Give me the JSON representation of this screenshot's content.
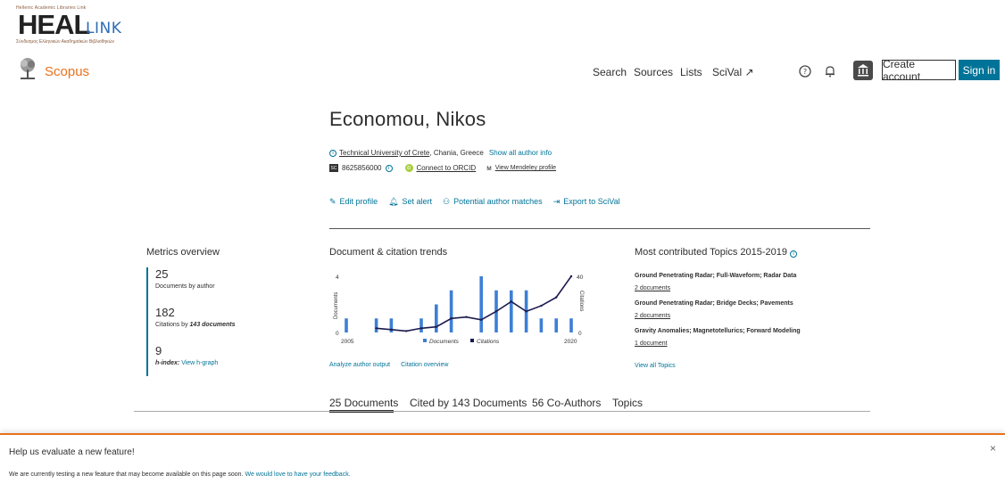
{
  "logo": {
    "tagline": "Hellenic Academic Libraries Link",
    "big": "HEAL",
    "link": "LINK",
    "subtitle": "Σύνδεσμος Ελληνικών Ακαδημαϊκών Βιβλιοθηκών"
  },
  "header": {
    "brand": "Scopus",
    "nav": {
      "search": "Search",
      "sources": "Sources",
      "lists": "Lists",
      "scival": "SciVal ↗"
    },
    "create_account": "Create account",
    "sign_in": "Sign in"
  },
  "author": {
    "name": "Economou, Nikos",
    "affiliation_link": "Technical University of Crete",
    "affiliation_rest": ", Chania, Greece",
    "show_all": "Show all author info",
    "scopus_id": "8625856000",
    "orcid": "Connect to ORCID",
    "mendeley": "View Mendeley profile"
  },
  "actions": {
    "edit": "Edit profile",
    "alert": "Set alert",
    "matches": "Potential author matches",
    "export": "Export to SciVal"
  },
  "metrics": {
    "title": "Metrics overview",
    "documents": "25",
    "documents_label": "Documents by author",
    "citations": "182",
    "citations_label_pre": "Citations by ",
    "citations_label_docs": "143 documents",
    "hindex": "9",
    "hindex_label": "h-index:",
    "hindex_link": "View h-graph"
  },
  "trends": {
    "title": "Document & citation trends",
    "analyze": "Analyze author output",
    "overview": "Citation overview"
  },
  "chart_data": {
    "type": "bar",
    "x_start": "2005",
    "x_end": "2020",
    "ylabel": "Documents",
    "y2label": "Citations",
    "ylim": [
      0,
      4
    ],
    "y2lim": [
      0,
      40
    ],
    "y_ticks": [
      "4",
      "0"
    ],
    "y2_ticks": [
      "40",
      "0"
    ],
    "years": [
      2005,
      2006,
      2007,
      2008,
      2009,
      2010,
      2011,
      2012,
      2013,
      2014,
      2015,
      2016,
      2017,
      2018,
      2019,
      2020
    ],
    "series": [
      {
        "name": "Documents",
        "values": [
          1,
          0,
          1,
          1,
          0,
          1,
          2,
          3,
          0,
          4,
          3,
          3,
          3,
          1,
          1,
          1
        ]
      },
      {
        "name": "Citations",
        "values": [
          null,
          null,
          3,
          2,
          1,
          3,
          4,
          10,
          11,
          9,
          15,
          22,
          15,
          19,
          25,
          40
        ]
      }
    ],
    "colors": {
      "documents": "#3d7fd6",
      "citations": "#1a1a4e"
    }
  },
  "topics": {
    "title": "Most contributed Topics 2015-2019",
    "items": [
      {
        "name": "Ground Penetrating Radar; Full-Waveform; Radar Data",
        "docs": "2 documents"
      },
      {
        "name": "Ground Penetrating Radar; Bridge Decks; Pavements",
        "docs": "2 documents"
      },
      {
        "name": "Gravity Anomalies; Magnetotellurics; Forward Modeling",
        "docs": "1 document"
      }
    ],
    "view_all": "View all Topics"
  },
  "tabs": [
    "25 Documents",
    "Cited by 143 Documents",
    "56 Co-Authors",
    "Topics"
  ],
  "banner": {
    "title": "Help us evaluate a new feature!",
    "text": "We are currently testing a new feature that may become available on this page soon.",
    "link": "We would love to have your feedback.",
    "close": "×"
  }
}
